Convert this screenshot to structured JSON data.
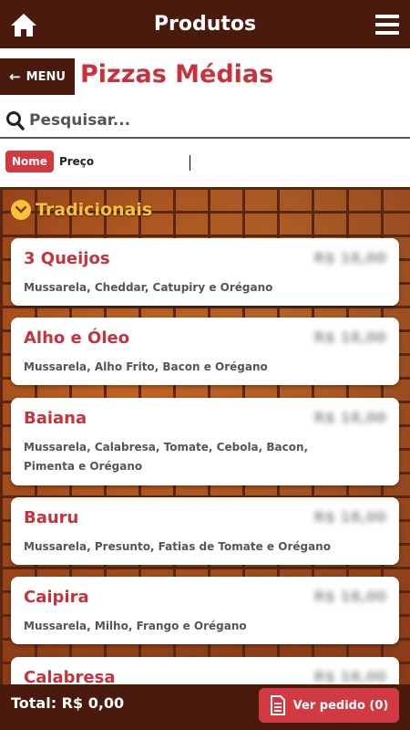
{
  "header": {
    "title": "Produtos"
  },
  "back_button": {
    "label": "MENU"
  },
  "page_title": "Pizzas Médias",
  "search": {
    "placeholder": "Pesquisar..."
  },
  "sort": {
    "active": "Nome",
    "other": "Preço"
  },
  "section": {
    "label": "Tradicionais"
  },
  "products": [
    {
      "name": "3 Queijos",
      "description": "Mussarela, Cheddar, Catupiry e Orégano",
      "price": "R$ 18,00"
    },
    {
      "name": "Alho e Óleo",
      "description": "Mussarela, Alho Frito, Bacon e Orégano",
      "price": "R$ 18,00"
    },
    {
      "name": "Baiana",
      "description": "Mussarela, Calabresa, Tomate, Cebola, Bacon, Pimenta e Orégano",
      "price": "R$ 18,00"
    },
    {
      "name": "Bauru",
      "description": "Mussarela, Presunto, Fatias de Tomate e Orégano",
      "price": "R$ 18,00"
    },
    {
      "name": "Caipira",
      "description": "Mussarela, Milho, Frango e Orégano",
      "price": "R$ 18,00"
    },
    {
      "name": "Calabresa",
      "description": "",
      "price": "R$ 18,00"
    }
  ],
  "footer": {
    "total": "Total: R$ 0,00",
    "order_button": "Ver pedido (0)"
  },
  "colors": {
    "brand_dark": "#4a1a0d",
    "accent_red": "#d23a42",
    "section_yellow": "#f5c23a"
  }
}
